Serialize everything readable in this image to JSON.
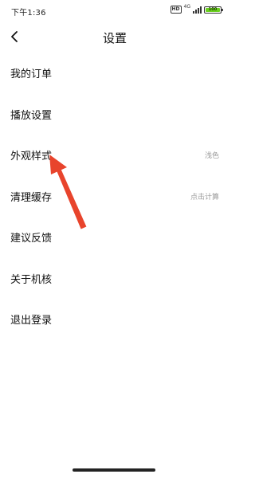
{
  "status_bar": {
    "time": "下午1:36",
    "hd": "HD",
    "network": "4G",
    "battery": "100"
  },
  "header": {
    "back_icon": "chevron-left-icon",
    "title": "设置"
  },
  "menu": [
    {
      "label": "我的订单",
      "value": ""
    },
    {
      "label": "播放设置",
      "value": ""
    },
    {
      "label": "外观样式",
      "value": "浅色"
    },
    {
      "label": "清理缓存",
      "value": "点击计算"
    },
    {
      "label": "建议反馈",
      "value": ""
    },
    {
      "label": "关于机核",
      "value": ""
    },
    {
      "label": "退出登录",
      "value": ""
    }
  ],
  "annotation": {
    "type": "red-arrow",
    "color": "#e8442c",
    "points_to": "外观样式"
  }
}
